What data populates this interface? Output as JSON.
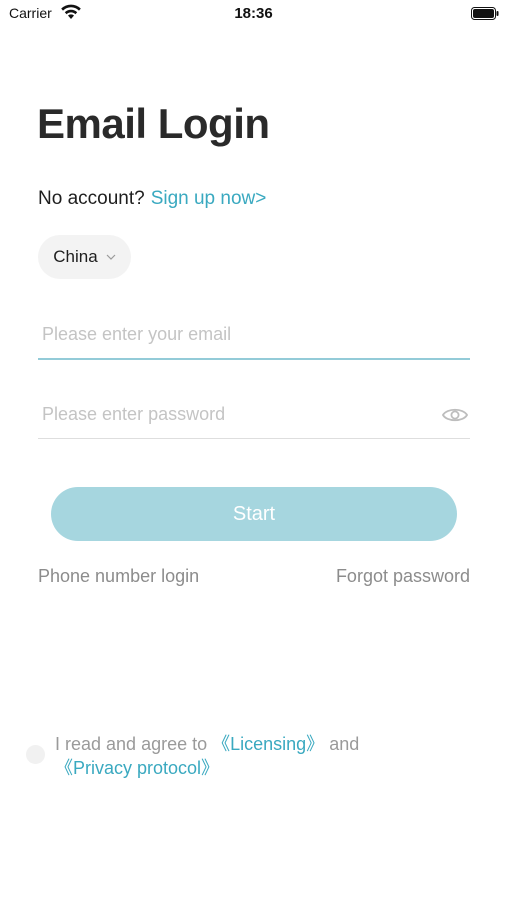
{
  "status_bar": {
    "carrier": "Carrier",
    "time": "18:36"
  },
  "title": "Email Login",
  "signup": {
    "prompt": "No account?",
    "link": "Sign up now>"
  },
  "country": {
    "selected": "China"
  },
  "email_field": {
    "value": "",
    "placeholder": "Please enter your email"
  },
  "password_field": {
    "value": "",
    "placeholder": "Please enter password"
  },
  "start_button": "Start",
  "phone_login": "Phone number login",
  "forgot_password": "Forgot password",
  "agreement": {
    "prefix": "I read and agree to ",
    "licensing": "《Licensing》",
    "and": " and ",
    "privacy": "《Privacy protocol》"
  },
  "colors": {
    "accent": "#3aa9c0",
    "button": "#a6d6df",
    "muted": "#8c8c8c"
  },
  "icons": {
    "wifi": "wifi-icon",
    "battery": "battery-icon",
    "chevron": "chevron-down-icon",
    "eye": "eye-icon"
  }
}
